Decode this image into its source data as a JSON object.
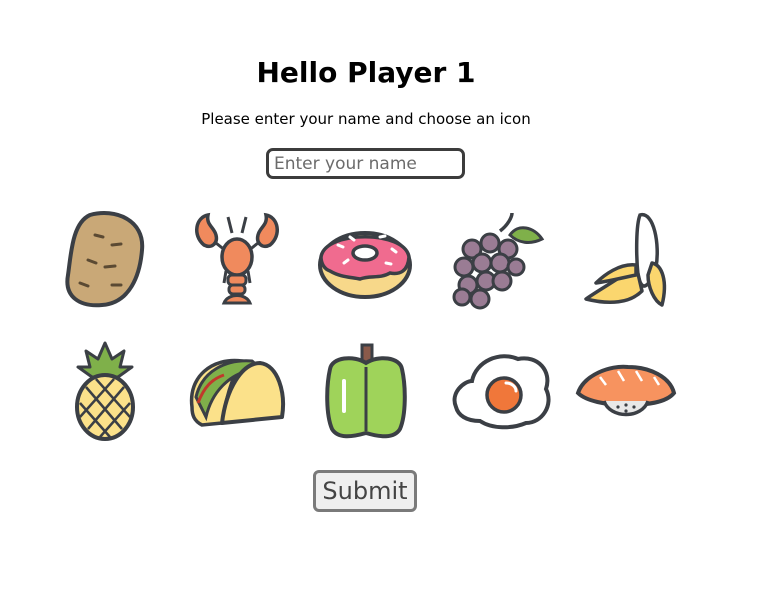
{
  "header": {
    "title": "Hello Player 1",
    "subtitle": "Please enter your name and choose an icon"
  },
  "name_input": {
    "value": "",
    "placeholder": "Enter your name"
  },
  "icons": [
    {
      "name": "potato-icon",
      "label": "potato"
    },
    {
      "name": "lobster-icon",
      "label": "lobster"
    },
    {
      "name": "donut-icon",
      "label": "donut"
    },
    {
      "name": "grapes-icon",
      "label": "grapes"
    },
    {
      "name": "banana-icon",
      "label": "banana"
    },
    {
      "name": "pineapple-icon",
      "label": "pineapple"
    },
    {
      "name": "taco-icon",
      "label": "taco"
    },
    {
      "name": "bell-pepper-icon",
      "label": "bell pepper"
    },
    {
      "name": "fried-egg-icon",
      "label": "fried egg"
    },
    {
      "name": "sushi-icon",
      "label": "sushi"
    }
  ],
  "submit": {
    "label": "Submit"
  },
  "colors": {
    "outline": "#3b3f45",
    "potato": "#c9a877",
    "lobster": "#f08a5d",
    "donut_icing": "#f06b8f",
    "donut_dough": "#f7d88a",
    "grapes": "#9a7c94",
    "banana": "#fbd66e",
    "pineapple_leaf": "#7fb04a",
    "taco_shell": "#fbe18a",
    "pepper": "#9fd35a",
    "egg_yolk": "#f0773a",
    "sushi_salmon": "#f7935f"
  }
}
